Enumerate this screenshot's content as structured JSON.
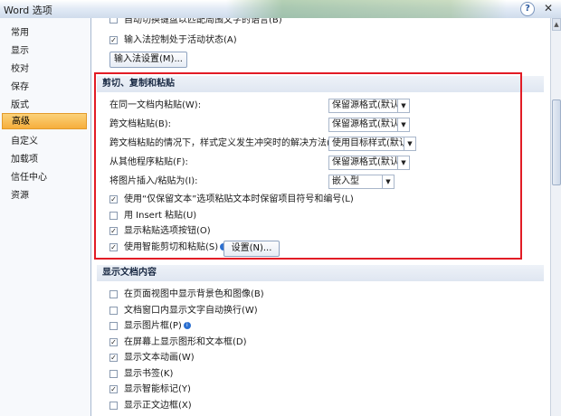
{
  "window": {
    "title": "Word 选项",
    "help_icon": "?",
    "close_icon": "✕"
  },
  "sidebar": {
    "items": [
      {
        "label": "常用"
      },
      {
        "label": "显示"
      },
      {
        "label": "校对"
      },
      {
        "label": "保存"
      },
      {
        "label": "版式"
      },
      {
        "label": "高级",
        "active": true
      },
      {
        "label": "自定义"
      },
      {
        "label": "加载项"
      },
      {
        "label": "信任中心"
      },
      {
        "label": "资源"
      }
    ]
  },
  "top": {
    "cut_checkbox_label": "自动切换键盘以匹配周围文字的语言(B)",
    "ime_checkbox_label": "输入法控制处于活动状态(A)",
    "ime_checked": true,
    "ime_button": "输入法设置(M)..."
  },
  "cut_copy_paste": {
    "header": "剪切、复制和粘贴",
    "settings": [
      {
        "label": "在同一文档内粘贴(W):",
        "value": "保留源格式(默认)"
      },
      {
        "label": "跨文档粘贴(B):",
        "value": "保留源格式(默认)"
      },
      {
        "label": "跨文档粘贴的情况下，样式定义发生冲突时的解决方法(E):",
        "value": "使用目标样式(默认)"
      },
      {
        "label": "从其他程序粘贴(F):",
        "value": "保留源格式(默认)"
      },
      {
        "label": "将图片插入/粘贴为(I):",
        "value": "嵌入型"
      }
    ],
    "checkboxes": [
      {
        "label": "使用“仅保留文本”选项粘贴文本时保留项目符号和编号(L)",
        "checked": true
      },
      {
        "label": "用 Insert 粘贴(U)",
        "checked": false
      },
      {
        "label": "显示粘贴选项按钮(O)",
        "checked": true
      },
      {
        "label": "使用智能剪切和粘贴(S)",
        "checked": true
      }
    ],
    "settings_button": "设置(N)..."
  },
  "show_document": {
    "header": "显示文档内容",
    "checkboxes": [
      {
        "label": "在页面视图中显示背景色和图像(B)",
        "checked": false
      },
      {
        "label": "文档窗口内显示文字自动换行(W)",
        "checked": false
      },
      {
        "label": "显示图片框(P)",
        "checked": false
      },
      {
        "label": "在屏幕上显示图形和文本框(D)",
        "checked": true
      },
      {
        "label": "显示文本动画(W)",
        "checked": true
      },
      {
        "label": "显示书签(K)",
        "checked": false
      },
      {
        "label": "显示智能标记(Y)",
        "checked": true
      },
      {
        "label": "显示正文边框(X)",
        "checked": false
      }
    ]
  },
  "colors": {
    "highlight_box": "#e21c25",
    "active_nav": "#f6ae3c"
  }
}
